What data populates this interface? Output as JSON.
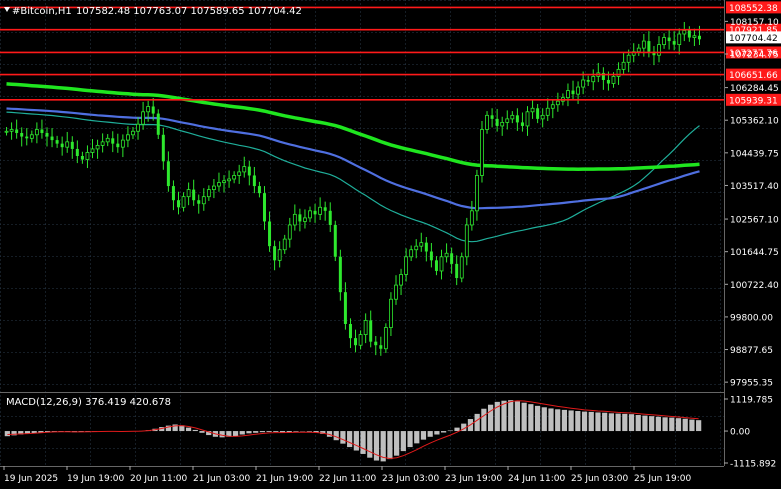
{
  "header": {
    "symbol_label": "#Bitcoin,H1",
    "ohlc": "107582.48 107763.07 107589.65 107704.42"
  },
  "price_axis": {
    "ticks": [
      "108157.10",
      "107234.75",
      "106284.45",
      "105362.10",
      "104439.75",
      "103517.40",
      "102567.10",
      "101644.75",
      "100722.40",
      "99800.00",
      "98877.65",
      "97955.35"
    ],
    "min": 97790,
    "max": 108620
  },
  "levels": [
    {
      "label": "108552.38",
      "value": 108552.38
    },
    {
      "label": "107921.85",
      "value": 107921.85
    },
    {
      "label": "107277.76",
      "value": 107277.76
    },
    {
      "label": "106651.66",
      "value": 106651.66
    },
    {
      "label": "105939.31",
      "value": 105939.31
    }
  ],
  "current_price": {
    "label": "107704.42",
    "value": 107704.42
  },
  "macd": {
    "title": "MACD(12,26,9) 376.419 420.678",
    "axis_ticks": [
      "1119.785",
      "0.00",
      "-1115.892"
    ],
    "max": 1119.785,
    "min": -1115.892,
    "histogram": [
      -180,
      -150,
      -120,
      -100,
      -80,
      -60,
      -40,
      -30,
      -20,
      -20,
      -40,
      -30,
      -20,
      -10,
      -5,
      0,
      -10,
      -20,
      -10,
      0,
      5,
      30,
      80,
      140,
      190,
      230,
      200,
      120,
      40,
      -60,
      -140,
      -200,
      -220,
      -200,
      -180,
      -120,
      -80,
      -60,
      -40,
      -30,
      -30,
      -50,
      -40,
      -20,
      -10,
      -20,
      -50,
      -100,
      -200,
      -320,
      -440,
      -560,
      -680,
      -800,
      -930,
      -1030,
      -1060,
      -980,
      -860,
      -700,
      -560,
      -430,
      -300,
      -200,
      -120,
      -50,
      20,
      120,
      260,
      420,
      600,
      780,
      920,
      1020,
      1060,
      1080,
      1040,
      990,
      940,
      880,
      830,
      790,
      760,
      740,
      720,
      700,
      680,
      670,
      650,
      640,
      620,
      610,
      600,
      590,
      560,
      540,
      520,
      500,
      480,
      470,
      450,
      430,
      400,
      380
    ],
    "signal": [
      -120,
      -110,
      -100,
      -90,
      -80,
      -60,
      -40,
      -30,
      -25,
      -25,
      -30,
      -30,
      -25,
      -20,
      -15,
      -12,
      -12,
      -14,
      -12,
      -8,
      0,
      15,
      45,
      90,
      140,
      180,
      190,
      160,
      110,
      40,
      -30,
      -100,
      -150,
      -180,
      -185,
      -170,
      -140,
      -110,
      -85,
      -65,
      -55,
      -55,
      -50,
      -45,
      -40,
      -40,
      -50,
      -70,
      -120,
      -200,
      -300,
      -400,
      -500,
      -610,
      -720,
      -830,
      -920,
      -960,
      -930,
      -860,
      -760,
      -650,
      -530,
      -420,
      -320,
      -230,
      -140,
      -40,
      80,
      220,
      380,
      540,
      700,
      840,
      950,
      1030,
      1060,
      1050,
      1020,
      980,
      940,
      900,
      860,
      830,
      800,
      770,
      740,
      720,
      700,
      690,
      670,
      650,
      640,
      630,
      610,
      590,
      570,
      550,
      530,
      510,
      490,
      470,
      450,
      430
    ]
  },
  "time_axis": {
    "labels": [
      "19 Jun 2025",
      "19 Jun 19:00",
      "20 Jun 11:00",
      "21 Jun 03:00",
      "21 Jun 19:00",
      "22 Jun 11:00",
      "23 Jun 03:00",
      "23 Jun 19:00",
      "24 Jun 11:00",
      "25 Jun 03:00",
      "25 Jun 19:00"
    ]
  },
  "close_series": [
    105050,
    105100,
    105000,
    104900,
    104850,
    104950,
    105100,
    105000,
    104900,
    104800,
    104700,
    104600,
    104750,
    104550,
    104350,
    104250,
    104450,
    104550,
    104650,
    104750,
    104850,
    104700,
    104600,
    104800,
    104950,
    105050,
    105250,
    105600,
    105750,
    105550,
    104950,
    104200,
    103500,
    103100,
    102900,
    103200,
    103400,
    103100,
    103000,
    103200,
    103400,
    103500,
    103600,
    103650,
    103700,
    103800,
    103900,
    104050,
    103800,
    103500,
    103300,
    102500,
    101800,
    101400,
    101700,
    102000,
    102400,
    102700,
    102500,
    102600,
    102800,
    102700,
    102900,
    102800,
    102400,
    101500,
    100500,
    99600,
    99200,
    99000,
    99300,
    99700,
    99100,
    99000,
    98900,
    99500,
    100300,
    100700,
    101000,
    101500,
    101700,
    101800,
    101900,
    101650,
    101400,
    101100,
    101500,
    101600,
    101300,
    100900,
    101500,
    102400,
    102800,
    103800,
    105100,
    105500,
    105400,
    105200,
    105300,
    105400,
    105500,
    105300,
    105200,
    105600,
    105700,
    105400,
    105500,
    105700,
    105800,
    105900,
    106000,
    106200,
    106100,
    106300,
    106500,
    106450,
    106600,
    106700,
    106500,
    106400,
    106600,
    106800,
    107000,
    107200,
    107300,
    107400,
    107600,
    107300,
    107200,
    107500,
    107700,
    107600,
    107500,
    107800,
    107900,
    107700,
    107750,
    107650
  ]
}
